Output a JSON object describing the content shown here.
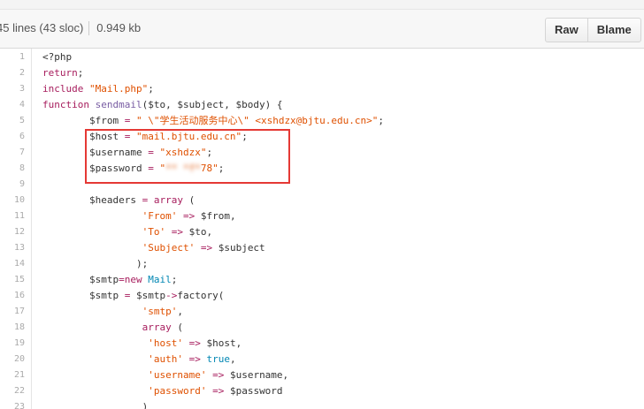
{
  "file_info": {
    "lines_text": "45 lines (43 sloc)",
    "size_text": "0.949 kb"
  },
  "toolbar": {
    "raw_label": "Raw",
    "blame_label": "Blame"
  },
  "colors": {
    "keyword": "#a71d5d",
    "string": "#df5000",
    "function": "#795da3",
    "class": "#0086b3",
    "highlight_border": "#e53935"
  },
  "code": {
    "lines": [
      {
        "n": "1",
        "tokens": [
          {
            "t": "<?php",
            "c": ""
          }
        ]
      },
      {
        "n": "2",
        "tokens": [
          {
            "t": "return",
            "c": "kw"
          },
          {
            "t": ";",
            "c": ""
          }
        ]
      },
      {
        "n": "3",
        "tokens": [
          {
            "t": "include",
            "c": "kw"
          },
          {
            "t": " ",
            "c": ""
          },
          {
            "t": "\"Mail.php\"",
            "c": "str"
          },
          {
            "t": ";",
            "c": ""
          }
        ]
      },
      {
        "n": "4",
        "tokens": [
          {
            "t": "function",
            "c": "kw"
          },
          {
            "t": " ",
            "c": ""
          },
          {
            "t": "sendmail",
            "c": "fn"
          },
          {
            "t": "($to, $subject, $body) {",
            "c": ""
          }
        ]
      },
      {
        "n": "5",
        "tokens": [
          {
            "t": "        $from ",
            "c": ""
          },
          {
            "t": "=",
            "c": "kw"
          },
          {
            "t": " ",
            "c": ""
          },
          {
            "t": "\" \\\"学生活动服务中心\\\" <xshdzx@bjtu.edu.cn>\"",
            "c": "str"
          },
          {
            "t": ";",
            "c": ""
          }
        ]
      },
      {
        "n": "6",
        "tokens": [
          {
            "t": "        $host ",
            "c": ""
          },
          {
            "t": "=",
            "c": "kw"
          },
          {
            "t": " ",
            "c": ""
          },
          {
            "t": "\"mail.bjtu.edu.cn\"",
            "c": "str"
          },
          {
            "t": ";",
            "c": ""
          }
        ]
      },
      {
        "n": "7",
        "tokens": [
          {
            "t": "        $username ",
            "c": ""
          },
          {
            "t": "=",
            "c": "kw"
          },
          {
            "t": " ",
            "c": ""
          },
          {
            "t": "\"xshdzx\"",
            "c": "str"
          },
          {
            "t": ";",
            "c": ""
          }
        ]
      },
      {
        "n": "8",
        "tokens": [
          {
            "t": "        $password ",
            "c": ""
          },
          {
            "t": "=",
            "c": "kw"
          },
          {
            "t": " ",
            "c": ""
          },
          {
            "t": "\"",
            "c": "str"
          },
          {
            "t": "** *f*",
            "c": "str blur"
          },
          {
            "t": "78\"",
            "c": "str"
          },
          {
            "t": ";",
            "c": ""
          }
        ]
      },
      {
        "n": "9",
        "tokens": []
      },
      {
        "n": "10",
        "tokens": [
          {
            "t": "        $headers ",
            "c": ""
          },
          {
            "t": "=",
            "c": "kw"
          },
          {
            "t": " ",
            "c": ""
          },
          {
            "t": "array",
            "c": "kw"
          },
          {
            "t": " (",
            "c": ""
          }
        ]
      },
      {
        "n": "11",
        "tokens": [
          {
            "t": "                 ",
            "c": ""
          },
          {
            "t": "'From'",
            "c": "str"
          },
          {
            "t": " ",
            "c": ""
          },
          {
            "t": "=>",
            "c": "kw"
          },
          {
            "t": " $from,",
            "c": ""
          }
        ]
      },
      {
        "n": "12",
        "tokens": [
          {
            "t": "                 ",
            "c": ""
          },
          {
            "t": "'To'",
            "c": "str"
          },
          {
            "t": " ",
            "c": ""
          },
          {
            "t": "=>",
            "c": "kw"
          },
          {
            "t": " $to,",
            "c": ""
          }
        ]
      },
      {
        "n": "13",
        "tokens": [
          {
            "t": "                 ",
            "c": ""
          },
          {
            "t": "'Subject'",
            "c": "str"
          },
          {
            "t": " ",
            "c": ""
          },
          {
            "t": "=>",
            "c": "kw"
          },
          {
            "t": " $subject",
            "c": ""
          }
        ]
      },
      {
        "n": "14",
        "tokens": [
          {
            "t": "                );",
            "c": ""
          }
        ]
      },
      {
        "n": "15",
        "tokens": [
          {
            "t": "        $smtp",
            "c": ""
          },
          {
            "t": "=new",
            "c": "kw"
          },
          {
            "t": " ",
            "c": ""
          },
          {
            "t": "Mail",
            "c": "cls"
          },
          {
            "t": ";",
            "c": ""
          }
        ]
      },
      {
        "n": "16",
        "tokens": [
          {
            "t": "        $smtp ",
            "c": ""
          },
          {
            "t": "=",
            "c": "kw"
          },
          {
            "t": " $smtp",
            "c": ""
          },
          {
            "t": "->",
            "c": "kw"
          },
          {
            "t": "factory(",
            "c": ""
          }
        ]
      },
      {
        "n": "17",
        "tokens": [
          {
            "t": "                 ",
            "c": ""
          },
          {
            "t": "'smtp'",
            "c": "str"
          },
          {
            "t": ",",
            "c": ""
          }
        ]
      },
      {
        "n": "18",
        "tokens": [
          {
            "t": "                 ",
            "c": ""
          },
          {
            "t": "array",
            "c": "kw"
          },
          {
            "t": " (",
            "c": ""
          }
        ]
      },
      {
        "n": "19",
        "tokens": [
          {
            "t": "                  ",
            "c": ""
          },
          {
            "t": "'host'",
            "c": "str"
          },
          {
            "t": " ",
            "c": ""
          },
          {
            "t": "=>",
            "c": "kw"
          },
          {
            "t": " $host,",
            "c": ""
          }
        ]
      },
      {
        "n": "20",
        "tokens": [
          {
            "t": "                  ",
            "c": ""
          },
          {
            "t": "'auth'",
            "c": "str"
          },
          {
            "t": " ",
            "c": ""
          },
          {
            "t": "=>",
            "c": "kw"
          },
          {
            "t": " ",
            "c": ""
          },
          {
            "t": "true",
            "c": "cls"
          },
          {
            "t": ",",
            "c": ""
          }
        ]
      },
      {
        "n": "21",
        "tokens": [
          {
            "t": "                  ",
            "c": ""
          },
          {
            "t": "'username'",
            "c": "str"
          },
          {
            "t": " ",
            "c": ""
          },
          {
            "t": "=>",
            "c": "kw"
          },
          {
            "t": " $username,",
            "c": ""
          }
        ]
      },
      {
        "n": "22",
        "tokens": [
          {
            "t": "                  ",
            "c": ""
          },
          {
            "t": "'password'",
            "c": "str"
          },
          {
            "t": " ",
            "c": ""
          },
          {
            "t": "=>",
            "c": "kw"
          },
          {
            "t": " $password",
            "c": ""
          }
        ]
      },
      {
        "n": "23",
        "tokens": [
          {
            "t": "                 )",
            "c": ""
          }
        ]
      }
    ]
  }
}
